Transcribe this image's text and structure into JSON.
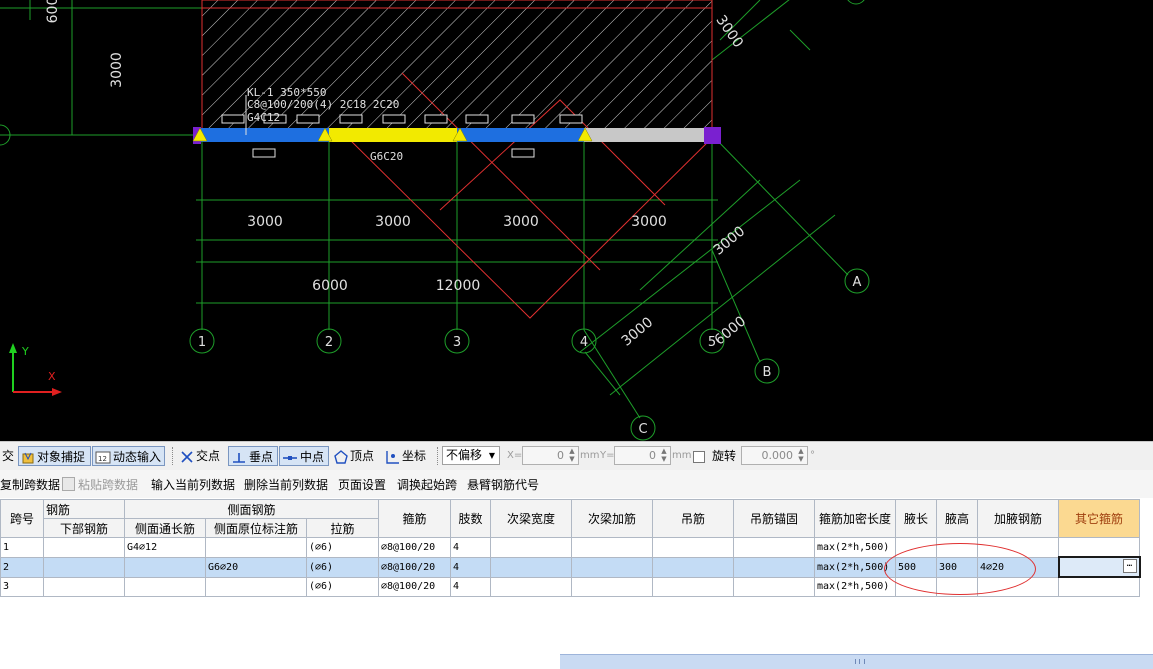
{
  "cad": {
    "beam_label": {
      "line1": "KL-1 350*550",
      "line2": "C8@100/200(4) 2C18 2C20",
      "line3": "G4C12"
    },
    "side_label": "G6C20",
    "dims_row1": [
      "3000",
      "3000",
      "3000",
      "3000"
    ],
    "dims_row2": [
      "6000",
      "12000"
    ],
    "dim_left_top": "600",
    "dim_left": "3000",
    "dim_top_right": "3000",
    "dim_diag_right": "3000",
    "dim_diag_right2": "6000",
    "dim_diag_lower": "3000",
    "axes": [
      "1",
      "2",
      "3",
      "4",
      "5"
    ],
    "axes_letter": [
      "A",
      "B",
      "C"
    ],
    "ucs": {
      "y": "Y",
      "x": "X"
    }
  },
  "snapbar": {
    "cut_label": "交",
    "object_snap": "对象捕捉",
    "dynamic_input": "动态输入",
    "intersection": "交点",
    "perpendicular": "垂点",
    "midpoint": "中点",
    "vertex": "顶点",
    "coordinate": "坐标",
    "offset_select": "不偏移",
    "x_label": "X=",
    "x_value": "0",
    "x_unit": "mm",
    "y_label": "Y=",
    "y_value": "0",
    "y_unit": "mm",
    "rotate_label": "旋转",
    "rotate_value": "0.000",
    "rotate_unit": "°"
  },
  "opbar": {
    "copy_span": "复制跨数据",
    "paste_span": "粘贴跨数据",
    "input_column": "输入当前列数据",
    "delete_column": "删除当前列数据",
    "page_setup": "页面设置",
    "adjust_start": "调换起始跨",
    "cantilever": "悬臂钢筋代号"
  },
  "table": {
    "group_rebar": "钢筋",
    "group_side": "侧面钢筋",
    "headers": {
      "span": "跨号",
      "bottom": "下部钢筋",
      "side_through": "侧面通长筋",
      "side_orig": "侧面原位标注筋",
      "tie": "拉筋",
      "stirrup": "箍筋",
      "legs": "肢数",
      "sec_width": "次梁宽度",
      "sec_add": "次梁加筋",
      "hanger": "吊筋",
      "hanger_anchor": "吊筋锚固",
      "dense_len": "箍筋加密长度",
      "haunch_len": "腋长",
      "haunch_h": "腋高",
      "haunch_bar": "加腋钢筋",
      "other": "其它箍筋"
    },
    "rows": [
      {
        "span": "1",
        "bottom": "",
        "side_through": "G4⌀12",
        "side_orig": "",
        "tie": "(⌀6)",
        "stirrup": "⌀8@100/20",
        "legs": "4",
        "sec_width": "",
        "sec_add": "",
        "hanger": "",
        "hanger_anchor": "",
        "dense_len": "max(2*h,500)",
        "haunch_len": "",
        "haunch_h": "",
        "haunch_bar": "",
        "other": ""
      },
      {
        "span": "2",
        "bottom": "",
        "side_through": "",
        "side_orig": "G6⌀20",
        "tie": "(⌀6)",
        "stirrup": "⌀8@100/20",
        "legs": "4",
        "sec_width": "",
        "sec_add": "",
        "hanger": "",
        "hanger_anchor": "",
        "dense_len": "max(2*h,500)",
        "haunch_len": "500",
        "haunch_h": "300",
        "haunch_bar": "4⌀20",
        "other": ""
      },
      {
        "span": "3",
        "bottom": "",
        "side_through": "",
        "side_orig": "",
        "tie": "(⌀6)",
        "stirrup": "⌀8@100/20",
        "legs": "4",
        "sec_width": "",
        "sec_add": "",
        "hanger": "",
        "hanger_anchor": "",
        "dense_len": "max(2*h,500)",
        "haunch_len": "",
        "haunch_h": "",
        "haunch_bar": "",
        "other": ""
      }
    ]
  }
}
